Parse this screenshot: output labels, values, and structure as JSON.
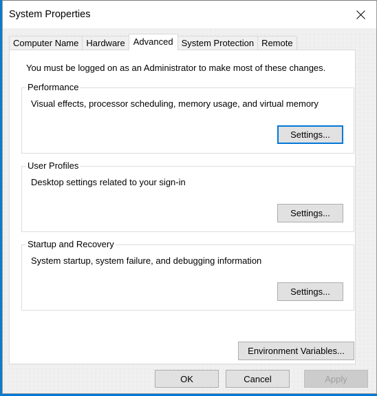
{
  "window": {
    "title": "System Properties",
    "close_icon": "close-x-icon"
  },
  "tabs": [
    {
      "label": "Computer Name",
      "active": false
    },
    {
      "label": "Hardware",
      "active": false
    },
    {
      "label": "Advanced",
      "active": true
    },
    {
      "label": "System Protection",
      "active": false
    },
    {
      "label": "Remote",
      "active": false
    }
  ],
  "advanced": {
    "admin_note": "You must be logged on as an Administrator to make most of these changes.",
    "groups": [
      {
        "label": "Performance",
        "description": "Visual effects, processor scheduling, memory usage, and virtual memory",
        "button_label": "Settings..."
      },
      {
        "label": "User Profiles",
        "description": "Desktop settings related to your sign-in",
        "button_label": "Settings..."
      },
      {
        "label": "Startup and Recovery",
        "description": "System startup, system failure, and debugging information",
        "button_label": "Settings..."
      }
    ],
    "env_button_label": "Environment Variables..."
  },
  "footer": {
    "ok_label": "OK",
    "cancel_label": "Cancel",
    "apply_label": "Apply"
  },
  "colors": {
    "focus_accent": "#0078d7",
    "desktop_blue": "#0078d7",
    "disabled_text": "#a0a0a0"
  }
}
